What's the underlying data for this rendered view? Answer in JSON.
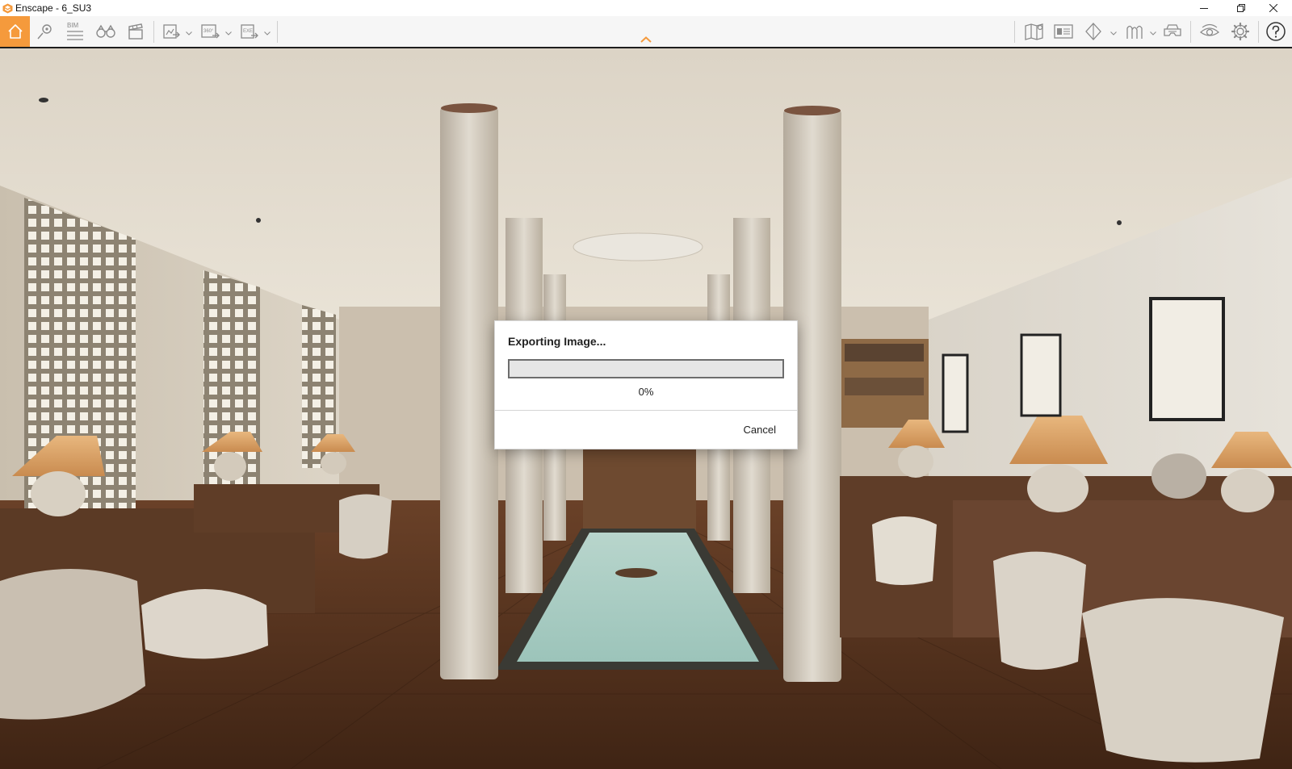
{
  "window": {
    "title": "Enscape - 6_SU3",
    "controls": [
      "minimize-button",
      "restore-button",
      "close-button"
    ]
  },
  "toolbar": {
    "accent_color": "#f59a3c",
    "bim_label": "BIM",
    "panorama_label": "360°",
    "exe_label": "EXE",
    "left_icons": [
      "home-icon",
      "location-pin-icon",
      "bim-icon",
      "binoculars-icon",
      "clapperboard-icon",
      "export-image-icon",
      "panorama-icon",
      "standalone-export-icon"
    ],
    "right_icons": [
      "map-icon",
      "asset-library-icon",
      "visual-settings-icon",
      "atmosphere-icon",
      "vr-headset-icon",
      "view-icon",
      "settings-icon",
      "help-icon"
    ]
  },
  "dialog": {
    "title": "Exporting Image...",
    "progress": 0,
    "progress_text": "0%",
    "cancel_label": "Cancel"
  }
}
